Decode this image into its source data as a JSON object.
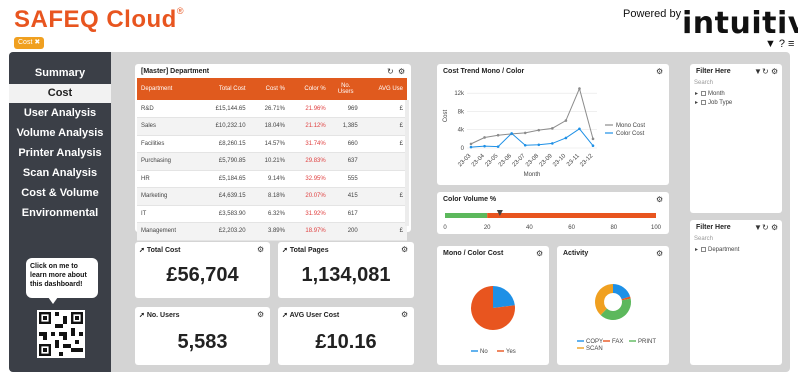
{
  "header": {
    "brand": "SAFEQ Cloud",
    "tm": "®",
    "cost_pill": "Cost ✖",
    "powered_by": "Powered by",
    "logo": "intuitive",
    "icons": [
      "filter-icon",
      "help-icon",
      "menu-icon"
    ]
  },
  "sidebar": {
    "items": [
      {
        "label": "Summary"
      },
      {
        "label": "Cost",
        "active": true
      },
      {
        "label": "User Analysis"
      },
      {
        "label": "Volume Analysis"
      },
      {
        "label": "Printer Analysis"
      },
      {
        "label": "Scan Analysis"
      },
      {
        "label": "Cost & Volume"
      },
      {
        "label": "Environmental"
      }
    ],
    "bubble": "Click on me to learn more about this dashboard!"
  },
  "department": {
    "title": "[Master] Department",
    "columns": [
      "Department",
      "Total Cost",
      "Cost %",
      "Color %",
      "No. Users",
      "AVG Use"
    ],
    "rows": [
      [
        "R&D",
        "£15,144.65",
        "26.71%",
        "21.96%",
        "969",
        "£"
      ],
      [
        "Sales",
        "£10,232.10",
        "18.04%",
        "21.12%",
        "1,385",
        "£"
      ],
      [
        "Facilities",
        "£8,260.15",
        "14.57%",
        "31.74%",
        "660",
        "£"
      ],
      [
        "Purchasing",
        "£5,790.85",
        "10.21%",
        "29.83%",
        "637",
        ""
      ],
      [
        "HR",
        "£5,184.65",
        "9.14%",
        "32.95%",
        "555",
        ""
      ],
      [
        "Marketing",
        "£4,639.15",
        "8.18%",
        "20.07%",
        "415",
        "£"
      ],
      [
        "IT",
        "£3,583.90",
        "6.32%",
        "31.92%",
        "617",
        ""
      ],
      [
        "Management",
        "£2,203.20",
        "3.89%",
        "18.97%",
        "200",
        "£"
      ]
    ],
    "red_column": 3
  },
  "kpis": {
    "total_cost": {
      "title": "Total Cost",
      "value": "£56,704"
    },
    "total_pages": {
      "title": "Total Pages",
      "value": "1,134,081"
    },
    "no_users": {
      "title": "No. Users",
      "value": "5,583"
    },
    "avg_user_cost": {
      "title": "AVG User Cost",
      "value": "£10.16"
    }
  },
  "trend": {
    "title": "Cost Trend Mono / Color",
    "ylabel": "Cost",
    "xlabel": "Month"
  },
  "color_volume": {
    "title": "Color Volume %",
    "ticks": [
      "0",
      "20",
      "40",
      "60",
      "80",
      "100"
    ],
    "green_to": 20,
    "marker": 26,
    "colors": {
      "green": "#5cb85c",
      "orange": "#e8551f"
    }
  },
  "mono_color_cost": {
    "title": "Mono / Color Cost",
    "legend": [
      "No",
      "Yes"
    ]
  },
  "activity": {
    "title": "Activity",
    "legend": [
      "COPY",
      "FAX",
      "PRINT",
      "SCAN"
    ]
  },
  "filter1": {
    "title": "Filter Here",
    "search": "Search",
    "items": [
      "Month",
      "Job Type"
    ]
  },
  "filter2": {
    "title": "Filter Here",
    "search": "Search",
    "items": [
      "Department"
    ]
  },
  "chart_data": [
    {
      "type": "line",
      "title": "Cost Trend Mono / Color",
      "xlabel": "Month",
      "ylabel": "Cost",
      "categories": [
        "23-03",
        "23-04",
        "23-05",
        "23-06",
        "23-07",
        "23-08",
        "23-09",
        "23-10",
        "23-11",
        "23-12"
      ],
      "series": [
        {
          "name": "Mono Cost",
          "color": "#8c8c8c",
          "values": [
            900,
            2300,
            2800,
            3100,
            3300,
            3900,
            4300,
            6000,
            13000,
            2000
          ]
        },
        {
          "name": "Color Cost",
          "color": "#1e90e6",
          "values": [
            200,
            400,
            300,
            3200,
            600,
            700,
            1000,
            2200,
            4200,
            500
          ]
        }
      ],
      "ylim": [
        0,
        14000
      ],
      "yticks": [
        "0",
        "4k",
        "8k",
        "12k"
      ],
      "yticks_values": [
        0,
        4000,
        8000,
        12000
      ],
      "legend": "right"
    },
    {
      "type": "pie",
      "title": "Mono / Color Cost",
      "categories": [
        "No",
        "Yes"
      ],
      "values": [
        23,
        77
      ],
      "colors": [
        "#1e90e6",
        "#e8551f"
      ]
    },
    {
      "type": "pie",
      "title": "Activity",
      "categories": [
        "COPY",
        "FAX",
        "PRINT",
        "SCAN"
      ],
      "values": [
        20,
        2,
        40,
        38
      ],
      "colors": [
        "#1e90e6",
        "#e8551f",
        "#5cb85c",
        "#f0a020"
      ]
    }
  ]
}
